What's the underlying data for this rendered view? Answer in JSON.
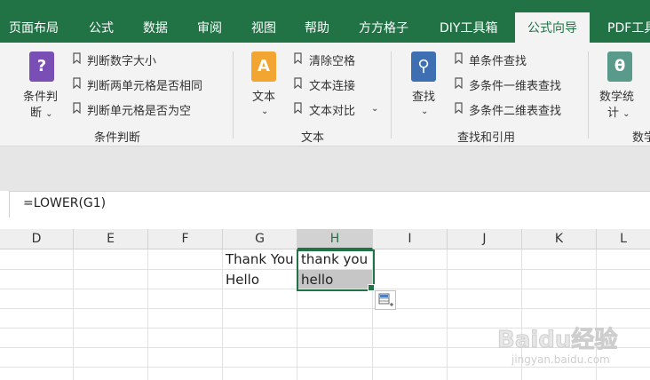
{
  "tabs": [
    {
      "label": "页面布局",
      "active": false
    },
    {
      "label": "公式",
      "active": false
    },
    {
      "label": "数据",
      "active": false
    },
    {
      "label": "审阅",
      "active": false
    },
    {
      "label": "视图",
      "active": false
    },
    {
      "label": "帮助",
      "active": false
    },
    {
      "label": "方方格子",
      "active": false
    },
    {
      "label": "DIY工具箱",
      "active": false
    },
    {
      "label": "公式向导",
      "active": true
    },
    {
      "label": "PDF工具",
      "active": false
    }
  ],
  "ribbon": {
    "groups": [
      {
        "label": "条件判断",
        "big_button": {
          "line1": "条件判",
          "line2": "断",
          "icon": "question-book-icon",
          "color": "#7a4fb5"
        },
        "items": [
          "判断数字大小",
          "判断两单元格是否相同",
          "判断单元格是否为空"
        ]
      },
      {
        "label": "文本",
        "big_button": {
          "line1": "文本",
          "icon": "text-a-book-icon",
          "color": "#f2a531"
        },
        "items": [
          "清除空格",
          "文本连接",
          "文本对比"
        ]
      },
      {
        "label": "查找和引用",
        "big_button": {
          "line1": "查找",
          "icon": "search-book-icon",
          "color": "#3e6fb3"
        },
        "items": [
          "单条件查找",
          "多条件一维表查找",
          "多条件二维表查找"
        ]
      },
      {
        "label": "数学",
        "big_button": {
          "line1": "数学统",
          "line2": "计",
          "icon": "theta-book-icon",
          "color": "#5a9a8a"
        },
        "items": []
      }
    ]
  },
  "formula_bar": {
    "text": "=LOWER(G1)"
  },
  "columns": [
    {
      "label": "D",
      "selected": false
    },
    {
      "label": "E",
      "selected": false
    },
    {
      "label": "F",
      "selected": false
    },
    {
      "label": "G",
      "selected": false
    },
    {
      "label": "H",
      "selected": true
    },
    {
      "label": "I",
      "selected": false
    },
    {
      "label": "J",
      "selected": false
    },
    {
      "label": "K",
      "selected": false
    },
    {
      "label": "L",
      "selected": false
    }
  ],
  "cells": {
    "G1": "Thank You",
    "H1": "thank you",
    "G2": "Hello",
    "H2": "hello"
  },
  "watermark": {
    "word": "Baidu经验",
    "url": "jingyan.baidu.com"
  },
  "colors": {
    "accent": "#217346",
    "ribbon_bg": "#f3f3f3",
    "selection_fill": "#c6c6c6"
  }
}
